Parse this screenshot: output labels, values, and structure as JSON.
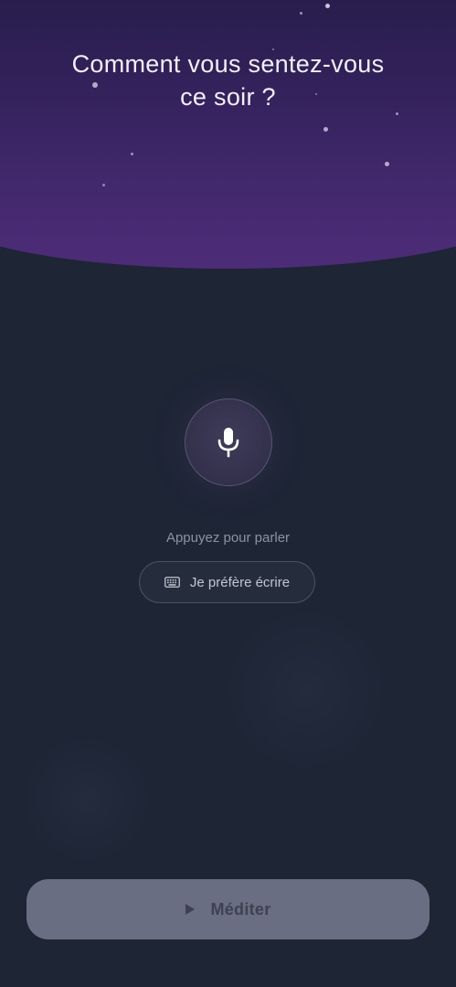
{
  "header": {
    "title_line1": "Comment vous sentez-vous",
    "title_line2": "ce soir ?"
  },
  "voice": {
    "icon": "microphone-icon",
    "hint": "Appuyez pour parler"
  },
  "write_option": {
    "icon": "keyboard-icon",
    "label": "Je préfère écrire"
  },
  "primary_action": {
    "icon": "play-icon",
    "label": "Méditer",
    "enabled": false
  },
  "colors": {
    "background": "#1e2535",
    "sky_top": "#261d4a",
    "sky_bottom": "#4d2c78",
    "button_disabled": "#6a6e82"
  }
}
